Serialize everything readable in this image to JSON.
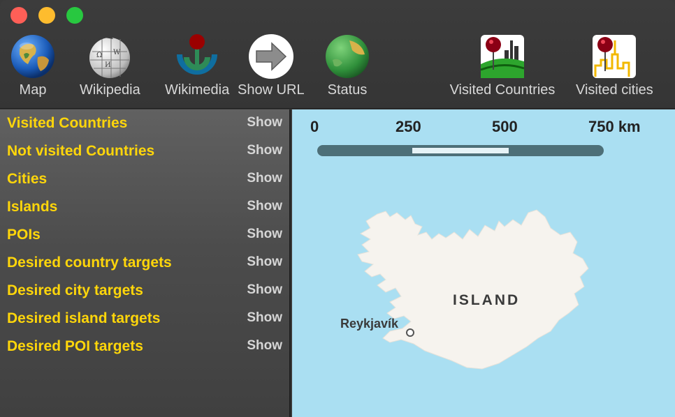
{
  "toolbar": {
    "map_label": "Map",
    "wikipedia_label": "Wikipedia",
    "wikimedia_label": "Wikimedia",
    "show_url_label": "Show URL",
    "status_label": "Status",
    "visited_countries_label": "Visited Countries",
    "visited_cities_label": "Visited cities"
  },
  "sidebar": {
    "items": [
      {
        "label": "Visited Countries",
        "action": "Show"
      },
      {
        "label": "Not visited Countries",
        "action": "Show"
      },
      {
        "label": "Cities",
        "action": "Show"
      },
      {
        "label": "Islands",
        "action": "Show"
      },
      {
        "label": "POIs",
        "action": "Show"
      },
      {
        "label": "Desired country targets",
        "action": "Show"
      },
      {
        "label": "Desired city targets",
        "action": "Show"
      },
      {
        "label": "Desired island targets",
        "action": "Show"
      },
      {
        "label": "Desired POI targets",
        "action": "Show"
      }
    ]
  },
  "map": {
    "scale": [
      "0",
      "250",
      "500",
      "750 km"
    ],
    "country_label": "ISLAND",
    "city_label": "Reykjavík"
  },
  "colors": {
    "accent_yellow": "#ffd60a",
    "water": "#aadff2",
    "land": "#f6f3ee"
  },
  "icons": {
    "map": "globe-icon",
    "wikipedia": "wikipedia-globe-icon",
    "wikimedia": "wikimedia-logo-icon",
    "show_url": "arrow-right-icon",
    "status": "status-globe-icon",
    "visited_countries": "pin-landscape-icon",
    "visited_cities": "pin-city-icon"
  }
}
